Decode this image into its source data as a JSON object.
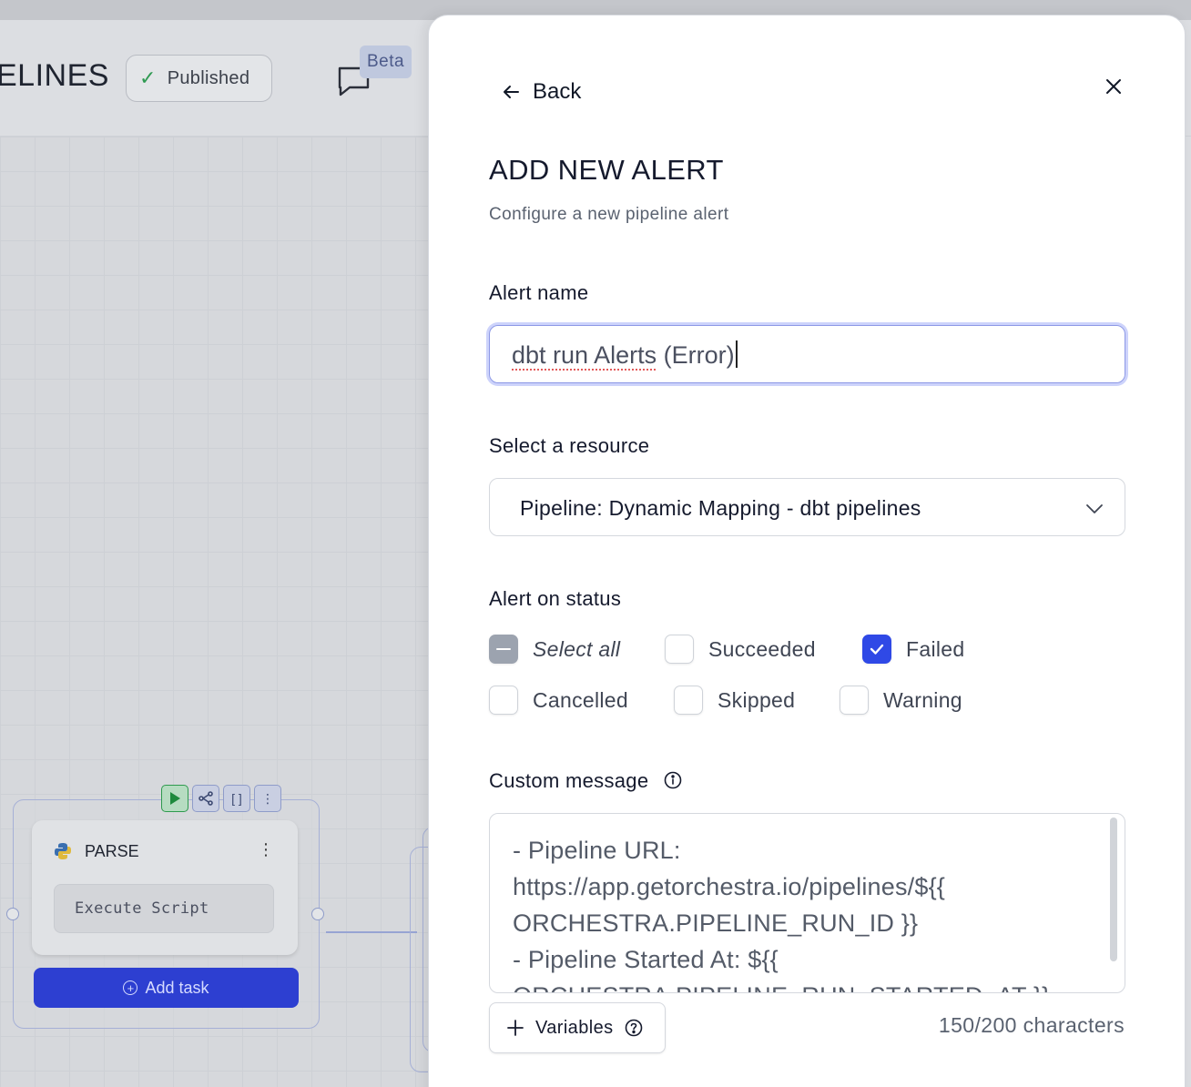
{
  "background": {
    "page_title": "ELINES",
    "published_label": "Published",
    "beta_label": "Beta",
    "task": {
      "name": "PARSE",
      "script_label": "Execute Script",
      "add_task_label": "Add task"
    }
  },
  "drawer": {
    "back_label": "Back",
    "title": "ADD NEW ALERT",
    "subtitle": "Configure a new pipeline alert",
    "alert_name": {
      "label": "Alert name",
      "value_misspelled": "dbt run Alerts",
      "value_rest": " (Error)"
    },
    "resource": {
      "label": "Select a resource",
      "selected": "Pipeline: Dynamic Mapping - dbt pipelines"
    },
    "status": {
      "label": "Alert on status",
      "options": [
        {
          "label": "Select all",
          "state": "indeterminate"
        },
        {
          "label": "Succeeded",
          "state": "unchecked"
        },
        {
          "label": "Failed",
          "state": "checked"
        },
        {
          "label": "Cancelled",
          "state": "unchecked"
        },
        {
          "label": "Skipped",
          "state": "unchecked"
        },
        {
          "label": "Warning",
          "state": "unchecked"
        }
      ]
    },
    "custom_message": {
      "label": "Custom message",
      "lines": [
        "- Pipeline URL:",
        "https://app.getorchestra.io/pipelines/${{",
        "ORCHESTRA.PIPELINE_RUN_ID }}",
        "- Pipeline Started At: ${{",
        "ORCHESTRA.PIPELINE_RUN_STARTED_AT }}"
      ]
    },
    "variables_label": "Variables",
    "char_count": "150/200 characters"
  },
  "colors": {
    "accent": "#2f49e6",
    "add_task_bg": "#2d3fd1",
    "success": "#2f9a52"
  }
}
